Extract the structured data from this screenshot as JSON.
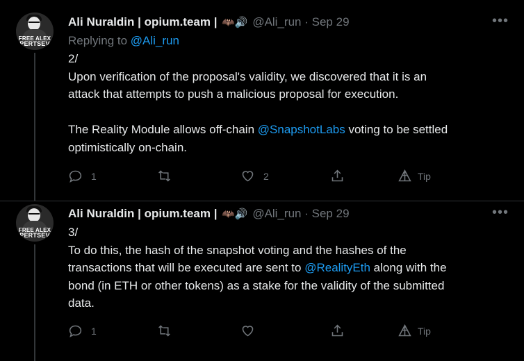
{
  "tweets": [
    {
      "author": "Ali Nuraldin | opium.team |",
      "emoji": "🦇🔊",
      "handle": "@Ali_run",
      "separator": "·",
      "date": "Sep 29",
      "avatar_text": [
        "FREE ALEX",
        "PERTSEV"
      ],
      "replying_prefix": "Replying to",
      "replying_handle": "@Ali_run",
      "number": "2/",
      "line1": "Upon verification of the proposal's validity, we discovered that it is an",
      "line2": "attack that attempts to push a malicious proposal for execution.",
      "line3a": "The Reality Module allows off-chain ",
      "line3link": "@SnapshotLabs",
      "line3b": " voting to be settled",
      "line4": "optimistically on-chain.",
      "reply_count": "1",
      "retweet_count": "",
      "like_count": "2",
      "tip_label": "Tip"
    },
    {
      "author": "Ali Nuraldin | opium.team |",
      "emoji": "🦇🔊",
      "handle": "@Ali_run",
      "separator": "·",
      "date": "Sep 29",
      "avatar_text": [
        "FREE ALEX",
        "PERTSEV"
      ],
      "number": "3/",
      "line1": "To do this, the hash of the snapshot voting and the hashes of the",
      "line2a": "transactions that will be executed are sent to ",
      "line2link": "@RealityEth",
      "line2b": " along with the",
      "line3": "bond (in ETH or other tokens) as a stake for the validity of the submitted",
      "line4": "data.",
      "reply_count": "1",
      "retweet_count": "",
      "like_count": "",
      "tip_label": "Tip"
    }
  ],
  "more_glyph": "•••",
  "icons": [
    "reply-icon",
    "retweet-icon",
    "like-icon",
    "share-icon",
    "tip-icon"
  ]
}
